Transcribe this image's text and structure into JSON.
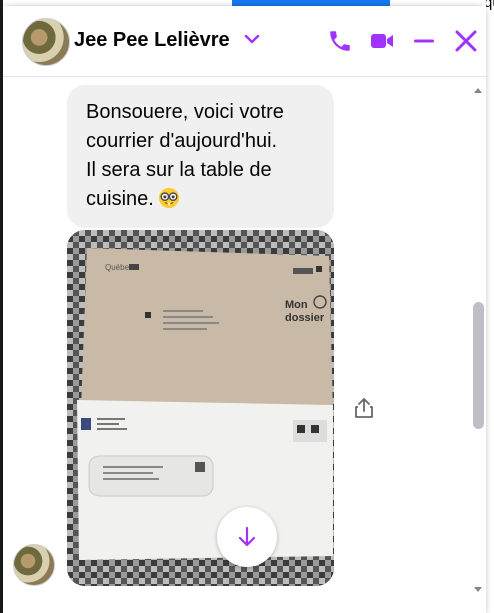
{
  "background": {
    "right_edge_text": "queb"
  },
  "header": {
    "contact_name": "Jee Pee Lelièvre",
    "icons": {
      "options": "chevron-down-icon",
      "call": "phone-icon",
      "video": "video-camera-icon",
      "minimize": "minimize-icon",
      "close": "close-icon"
    },
    "accent_color": "#a033ff"
  },
  "message": {
    "text_lines": [
      "Bonsouere, voici votre",
      "courrier d'aujourd'hui.",
      "Il sera sur la table de",
      "cuisine."
    ],
    "emoji": "nerd-face-emoji"
  },
  "photo": {
    "envelope_top": {
      "brand": "Québec",
      "label_line1": "Mon",
      "label_line2": "dossier"
    }
  },
  "actions": {
    "share": "share-icon",
    "scroll_down": "arrow-down-icon"
  }
}
